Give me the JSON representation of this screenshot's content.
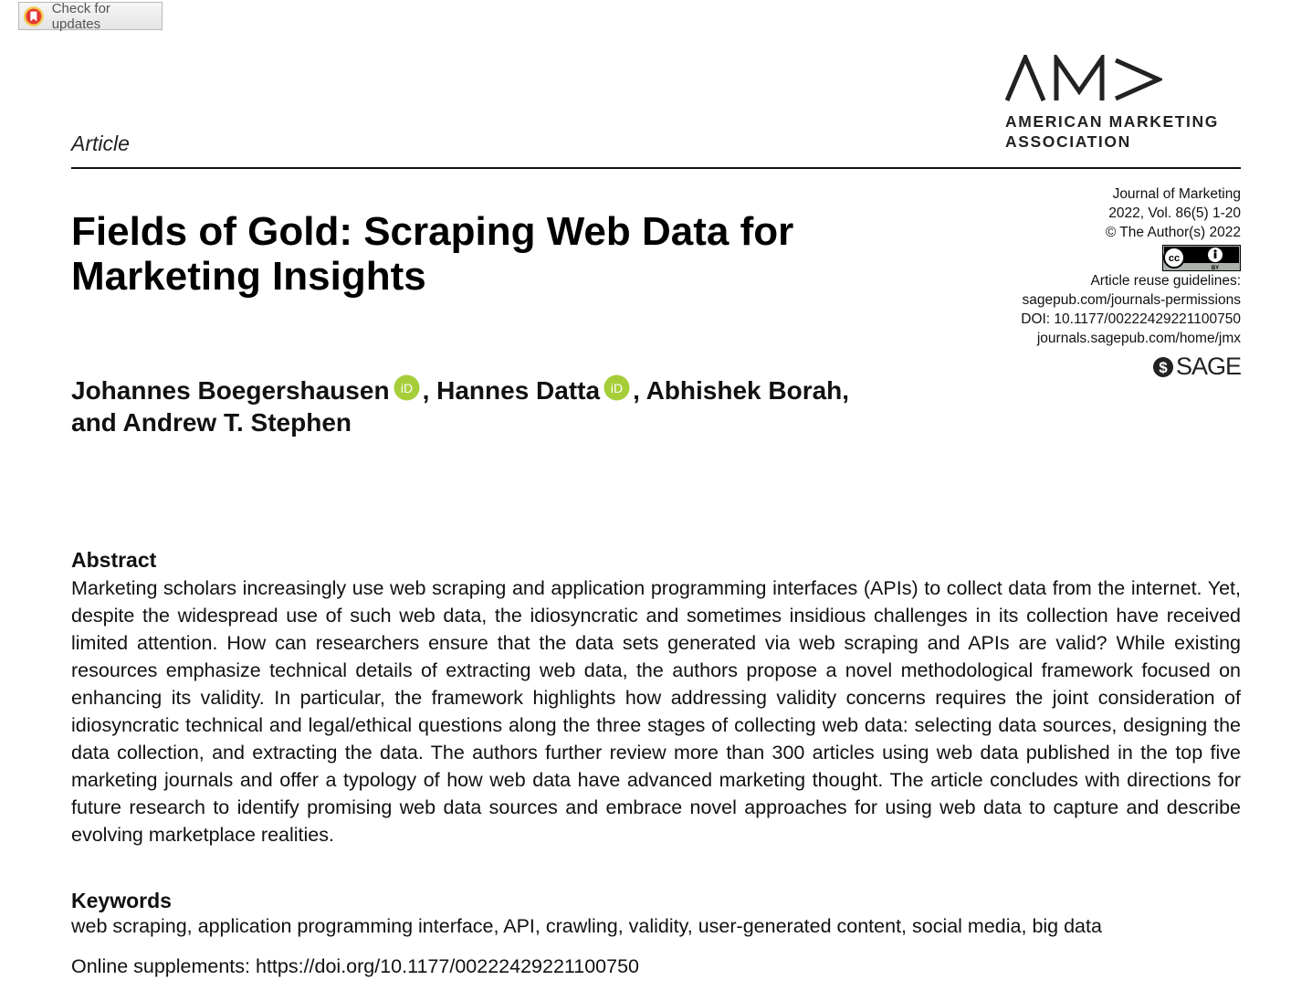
{
  "badge": {
    "label": "Check for updates"
  },
  "header": {
    "article_type": "Article"
  },
  "publisher": {
    "org_line1": "AMERICAN MARKETING",
    "org_line2": "ASSOCIATION",
    "sage": "SAGE"
  },
  "meta": {
    "journal": "Journal of Marketing",
    "volume": "2022, Vol. 86(5) 1-20",
    "copyright": "© The Author(s) 2022",
    "license_icon_text": "BY",
    "reuse_label": "Article reuse guidelines:",
    "reuse_link": "sagepub.com/journals-permissions",
    "doi": "DOI: 10.1177/00222429221100750",
    "journal_link": "journals.sagepub.com/home/jmx"
  },
  "title": {
    "line1": "Fields of Gold: Scraping Web Data for",
    "line2": "Marketing Insights"
  },
  "authors": {
    "a1": "Johannes Boegershausen",
    "sep1": ", ",
    "a2": "Hannes Datta",
    "sep2": ", Abhishek Borah,",
    "line2": "and Andrew T. Stephen"
  },
  "abstract": {
    "heading": "Abstract",
    "text": "Marketing scholars increasingly use web scraping and application programming interfaces (APIs) to collect data from the internet. Yet, despite the widespread use of such web data, the idiosyncratic and sometimes insidious challenges in its collection have received limited attention. How can researchers ensure that the data sets generated via web scraping and APIs are valid? While existing resources emphasize technical details of extracting web data, the authors propose a novel methodological frame­work focused on enhancing its validity. In particular, the framework highlights how addressing validity concerns requires the joint consideration of idiosyncratic technical and legal/ethical questions along the three stages of collecting web data: selecting data sources, designing the data collection, and extracting the data. The authors further review more than 300 articles using web data published in the top five marketing journals and offer a typology of how web data have advanced marketing thought. The article concludes with directions for future research to identify promising web data sources and embrace novel approaches for using web data to capture and describe evolving marketplace realities."
  },
  "keywords": {
    "heading": "Keywords",
    "text": "web scraping, application programming interface, API, crawling, validity, user-generated content, social media, big data"
  },
  "supplements": {
    "label": "Online supplements: ",
    "link": "https://doi.org/10.1177/00222429221100750"
  },
  "colors": {
    "orcid": "#a6ce39",
    "badge_icon": "#e53935",
    "rule": "#111111"
  }
}
